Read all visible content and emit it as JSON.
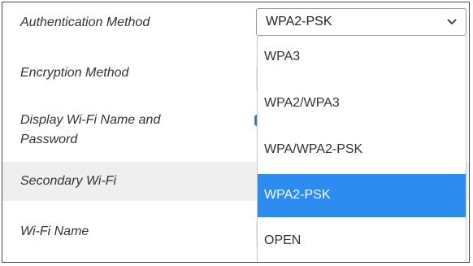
{
  "form": {
    "rows": [
      {
        "label": "Authentication Method"
      },
      {
        "label": "Encryption Method"
      },
      {
        "label_line1": "Display Wi-Fi Name and",
        "label_line2": "Password"
      },
      {
        "label": "Secondary Wi-Fi"
      },
      {
        "label": "Wi-Fi Name"
      }
    ]
  },
  "auth_select": {
    "selected": "WPA2-PSK",
    "options": [
      "WPA3",
      "WPA2/WPA3",
      "WPA/WPA2-PSK",
      "WPA2-PSK",
      "OPEN"
    ],
    "selected_index": 3
  },
  "colors": {
    "selected_option": "#2d8cf0",
    "shaded_row": "#efefef"
  },
  "icons": {
    "select_arrow": "chevron-down-icon"
  }
}
